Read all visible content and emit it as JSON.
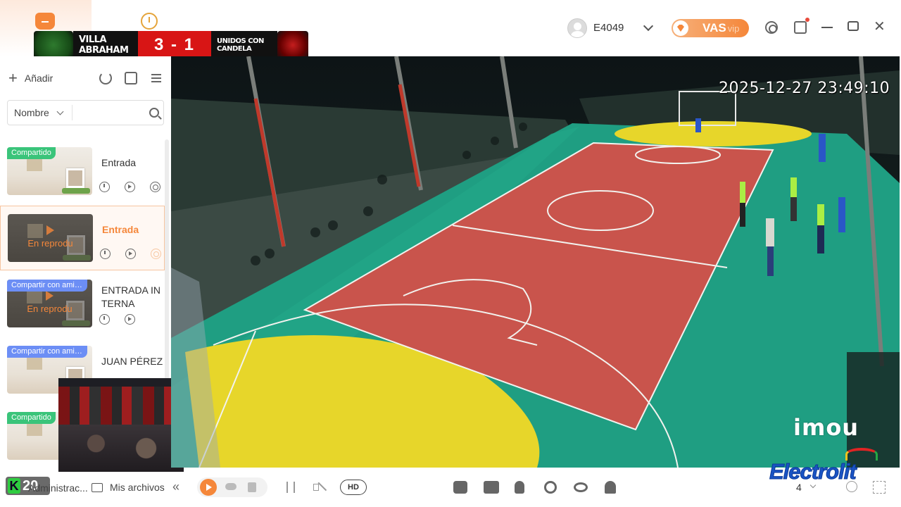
{
  "titlebar": {
    "user_name": "E4049",
    "vas_label": "VAS",
    "vip_label": "vip"
  },
  "scoreboard": {
    "home_team": "VILLA ABRAHAM",
    "score": "3 - 1",
    "away_team": "UNIDOS CON CANDELA"
  },
  "sidebar": {
    "add_label": "Añadir",
    "sort_label": "Nombre",
    "search_placeholder": "",
    "cameras": [
      {
        "name": "Entrada",
        "badge": "Compartido",
        "badge_color": "#3ac47a",
        "status": ""
      },
      {
        "name": "Entrada",
        "badge": "",
        "status": "En reprodu",
        "active": true
      },
      {
        "name": "ENTRADA INTERNA",
        "badge": "Compartir con amigos",
        "badge_color": "#6c8ef5",
        "status": "En reprodu"
      },
      {
        "name": "JUAN PÉREZ",
        "badge": "Compartir con amigos",
        "badge_color": "#6c8ef5",
        "status": ""
      },
      {
        "name": "",
        "badge": "Compartido",
        "badge_color": "#3ac47a",
        "status": ""
      }
    ],
    "footer": {
      "k_badge_number": "20",
      "admin_label": "Administrac...",
      "files_label": "Mis archivos"
    }
  },
  "video": {
    "timestamp": "2025-12-27 23:49:10",
    "watermark": "imou"
  },
  "toolbar": {
    "hd_label": "HD",
    "layout_count": "4",
    "sponsor": "Electrolit"
  },
  "colors": {
    "accent": "#f5873a",
    "score_red": "#d81515",
    "shared_green": "#3ac47a",
    "friends_blue": "#6c8ef5",
    "court_red": "#c9544c",
    "court_green": "#1f9e82",
    "court_yellow": "#e7d62a"
  },
  "icons": [
    "home-icon",
    "clock-icon",
    "user-avatar",
    "chevron-down-icon",
    "gem-icon",
    "target-icon",
    "message-icon",
    "minimize-icon",
    "maximize-icon",
    "close-icon",
    "plus-icon",
    "refresh-icon",
    "sort-icon",
    "list-icon",
    "search-icon",
    "folder-icon",
    "play-icon",
    "cloud-icon",
    "sd-card-icon",
    "pause-icon",
    "mute-icon",
    "camera-icon",
    "record-icon",
    "microphone-icon",
    "ptz-icon",
    "eye-icon",
    "bell-icon",
    "zoom-icon",
    "fullscreen-icon"
  ]
}
